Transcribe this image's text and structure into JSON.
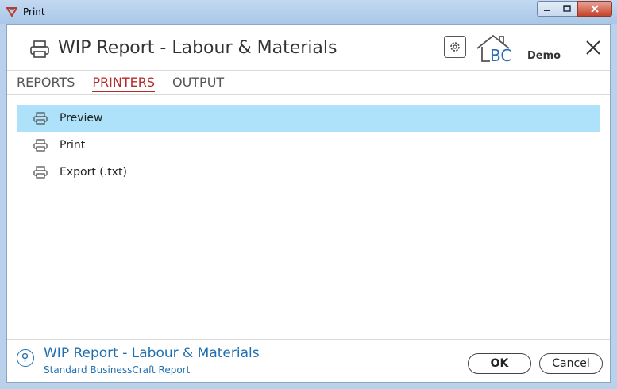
{
  "window": {
    "title": "Print",
    "controls": [
      "minimize-icon",
      "maximize-icon",
      "close-icon"
    ]
  },
  "header": {
    "icon": "printer-icon",
    "title": "WIP Report - Labour & Materials",
    "settings_icon": "gear-icon",
    "logo_text": "BC",
    "brand_label": "Demo",
    "close_icon": "close-icon"
  },
  "tabs": [
    {
      "label": "REPORTS",
      "active": false
    },
    {
      "label": "PRINTERS",
      "active": true
    },
    {
      "label": "OUTPUT",
      "active": false
    }
  ],
  "printers": [
    {
      "label": "Preview",
      "selected": true,
      "icon": "printer-icon"
    },
    {
      "label": "Print",
      "selected": false,
      "icon": "printer-icon"
    },
    {
      "label": "Export (.txt)",
      "selected": false,
      "icon": "printer-icon"
    }
  ],
  "footer": {
    "help_icon": "help-icon",
    "title": "WIP Report - Labour & Materials",
    "subtitle": "Standard BusinessCraft Report",
    "ok_label": "OK",
    "cancel_label": "Cancel"
  },
  "colors": {
    "accent_tab": "#b52a2a",
    "selection": "#aee2fb",
    "link_blue": "#1f6fb0"
  }
}
